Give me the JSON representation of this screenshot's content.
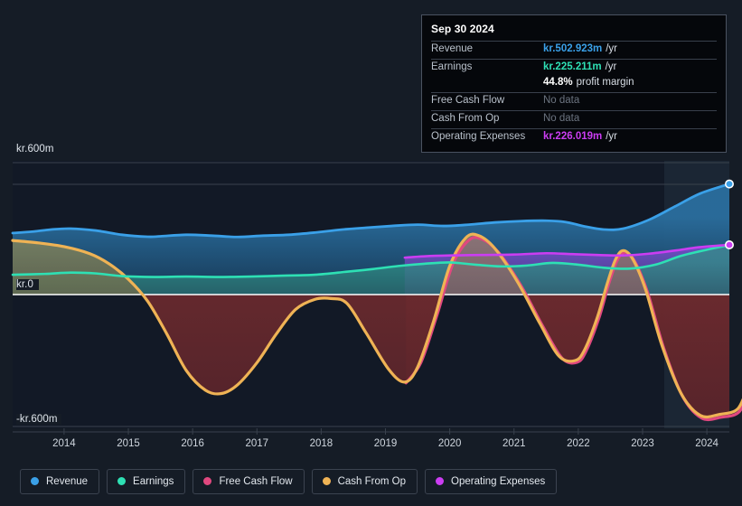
{
  "tooltip": {
    "date": "Sep 30 2024",
    "rows": [
      {
        "label": "Revenue",
        "value": "kr.502.923m",
        "unit": "/yr",
        "color": "#3aa0e8",
        "nodata": false
      },
      {
        "label": "Earnings",
        "value": "kr.225.211m",
        "unit": "/yr",
        "color": "#2ee0b4",
        "nodata": false
      },
      {
        "label": "",
        "value": "44.8%",
        "unit": "profit margin",
        "color": "#ffffff",
        "nodata": false
      },
      {
        "label": "Free Cash Flow",
        "value": "No data",
        "unit": "",
        "color": "#6c7480",
        "nodata": true
      },
      {
        "label": "Cash From Op",
        "value": "No data",
        "unit": "",
        "color": "#6c7480",
        "nodata": true
      },
      {
        "label": "Operating Expenses",
        "value": "kr.226.019m",
        "unit": "/yr",
        "color": "#cb3df2",
        "nodata": false
      }
    ]
  },
  "legend": {
    "items": [
      {
        "label": "Revenue",
        "color": "#3aa0e8"
      },
      {
        "label": "Earnings",
        "color": "#2ee0b4"
      },
      {
        "label": "Free Cash Flow",
        "color": "#e0487f"
      },
      {
        "label": "Cash From Op",
        "color": "#efb355"
      },
      {
        "label": "Operating Expenses",
        "color": "#cb3df2"
      }
    ]
  },
  "chart_data": {
    "type": "area",
    "title": "",
    "xlabel": "",
    "ylabel": "",
    "currency_prefix": "kr.",
    "units": "m",
    "ylim": [
      -600,
      600
    ],
    "y_ticks": [
      600,
      0,
      -600
    ],
    "y_tick_labels": [
      "kr.600m",
      "kr.0",
      "-kr.600m"
    ],
    "grid": true,
    "legend_position": "bottom",
    "x": [
      "2014",
      "2015",
      "2016",
      "2017",
      "2018",
      "2019",
      "2020",
      "2021",
      "2022",
      "2023",
      "2024"
    ],
    "xlim": [
      2013.7,
      2024.85
    ],
    "series": [
      {
        "name": "Revenue",
        "color": "#3aa0e8",
        "fill": "#174163",
        "end_marker": true,
        "points": [
          [
            2013.7,
            280
          ],
          [
            2014.0,
            286
          ],
          [
            2014.3,
            296
          ],
          [
            2014.6,
            300
          ],
          [
            2015.0,
            291
          ],
          [
            2015.4,
            272
          ],
          [
            2015.8,
            263
          ],
          [
            2016.0,
            265
          ],
          [
            2016.4,
            272
          ],
          [
            2016.8,
            268
          ],
          [
            2017.2,
            262
          ],
          [
            2017.6,
            268
          ],
          [
            2018.0,
            272
          ],
          [
            2018.4,
            282
          ],
          [
            2018.8,
            295
          ],
          [
            2019.2,
            304
          ],
          [
            2019.6,
            312
          ],
          [
            2020.0,
            318
          ],
          [
            2020.4,
            312
          ],
          [
            2020.8,
            318
          ],
          [
            2021.2,
            328
          ],
          [
            2021.6,
            334
          ],
          [
            2022.0,
            336
          ],
          [
            2022.3,
            330
          ],
          [
            2022.6,
            310
          ],
          [
            2022.9,
            296
          ],
          [
            2023.2,
            300
          ],
          [
            2023.6,
            340
          ],
          [
            2024.0,
            400
          ],
          [
            2024.4,
            460
          ],
          [
            2024.85,
            503
          ]
        ]
      },
      {
        "name": "Operating Expenses",
        "color": "#cb3df2",
        "fill": "#4e3a8e",
        "end_marker": true,
        "starts_at": 2019.8,
        "points": [
          [
            2019.8,
            168
          ],
          [
            2020.1,
            174
          ],
          [
            2020.5,
            178
          ],
          [
            2021.0,
            180
          ],
          [
            2021.5,
            182
          ],
          [
            2022.0,
            188
          ],
          [
            2022.4,
            184
          ],
          [
            2022.8,
            180
          ],
          [
            2023.2,
            178
          ],
          [
            2023.6,
            186
          ],
          [
            2024.0,
            200
          ],
          [
            2024.4,
            216
          ],
          [
            2024.85,
            226
          ]
        ]
      },
      {
        "name": "Earnings",
        "color": "#2ee0b4",
        "fill": "#1d6a66",
        "end_marker": false,
        "points": [
          [
            2013.7,
            90
          ],
          [
            2014.2,
            94
          ],
          [
            2014.6,
            100
          ],
          [
            2015.0,
            96
          ],
          [
            2015.4,
            84
          ],
          [
            2015.9,
            80
          ],
          [
            2016.4,
            82
          ],
          [
            2016.9,
            80
          ],
          [
            2017.4,
            82
          ],
          [
            2017.9,
            86
          ],
          [
            2018.4,
            90
          ],
          [
            2018.9,
            104
          ],
          [
            2019.3,
            116
          ],
          [
            2019.7,
            130
          ],
          [
            2020.1,
            140
          ],
          [
            2020.5,
            146
          ],
          [
            2020.9,
            136
          ],
          [
            2021.3,
            128
          ],
          [
            2021.7,
            132
          ],
          [
            2022.1,
            144
          ],
          [
            2022.5,
            136
          ],
          [
            2022.9,
            122
          ],
          [
            2023.3,
            118
          ],
          [
            2023.7,
            136
          ],
          [
            2024.1,
            176
          ],
          [
            2024.5,
            204
          ],
          [
            2024.85,
            225
          ]
        ]
      },
      {
        "name": "Cash From Op",
        "color": "#efb355",
        "fill_pos": "#6b6a4a",
        "fill_neg": "#5a2326",
        "end_marker": false,
        "ends_at": 2023.98,
        "points": [
          [
            2013.7,
            246
          ],
          [
            2014.1,
            235
          ],
          [
            2014.5,
            218
          ],
          [
            2014.9,
            186
          ],
          [
            2015.2,
            140
          ],
          [
            2015.5,
            70
          ],
          [
            2015.8,
            -30
          ],
          [
            2016.1,
            -180
          ],
          [
            2016.4,
            -345
          ],
          [
            2016.7,
            -435
          ],
          [
            2016.95,
            -450
          ],
          [
            2017.2,
            -410
          ],
          [
            2017.5,
            -310
          ],
          [
            2017.8,
            -180
          ],
          [
            2018.1,
            -68
          ],
          [
            2018.4,
            -22
          ],
          [
            2018.65,
            -18
          ],
          [
            2018.9,
            -40
          ],
          [
            2019.2,
            -175
          ],
          [
            2019.55,
            -340
          ],
          [
            2019.8,
            -398
          ],
          [
            2020.0,
            -330
          ],
          [
            2020.25,
            -120
          ],
          [
            2020.5,
            130
          ],
          [
            2020.75,
            258
          ],
          [
            2020.95,
            268
          ],
          [
            2021.2,
            210
          ],
          [
            2021.55,
            60
          ],
          [
            2021.9,
            -130
          ],
          [
            2022.2,
            -280
          ],
          [
            2022.45,
            -300
          ],
          [
            2022.6,
            -250
          ],
          [
            2022.8,
            -100
          ],
          [
            2022.95,
            50
          ],
          [
            2023.08,
            160
          ],
          [
            2023.2,
            200
          ],
          [
            2023.35,
            160
          ],
          [
            2023.55,
            20
          ],
          [
            2023.8,
            -230
          ],
          [
            2024.1,
            -450
          ],
          [
            2024.4,
            -550
          ],
          [
            2024.7,
            -545
          ],
          [
            2024.98,
            -520
          ],
          [
            2025.15,
            -420
          ],
          [
            2025.3,
            -395
          ]
        ]
      },
      {
        "name": "Free Cash Flow",
        "color": "#e0487f",
        "fill_pos": "#7a5d6e",
        "fill_neg": "#5a2326",
        "end_marker": false,
        "starts_at": 2019.82,
        "ends_at": 2023.98,
        "points": [
          [
            2019.82,
            -402
          ],
          [
            2020.05,
            -310
          ],
          [
            2020.3,
            -95
          ],
          [
            2020.55,
            140
          ],
          [
            2020.8,
            248
          ],
          [
            2021.0,
            252
          ],
          [
            2021.25,
            195
          ],
          [
            2021.6,
            45
          ],
          [
            2021.95,
            -145
          ],
          [
            2022.25,
            -290
          ],
          [
            2022.48,
            -308
          ],
          [
            2022.62,
            -258
          ],
          [
            2022.82,
            -108
          ],
          [
            2022.97,
            45
          ],
          [
            2023.1,
            152
          ],
          [
            2023.22,
            192
          ],
          [
            2023.38,
            150
          ],
          [
            2023.58,
            8
          ],
          [
            2023.83,
            -244
          ],
          [
            2024.12,
            -462
          ],
          [
            2024.42,
            -562
          ],
          [
            2024.72,
            -558
          ],
          [
            2025.0,
            -534
          ],
          [
            2025.17,
            -432
          ],
          [
            2025.32,
            -408
          ]
        ]
      }
    ]
  }
}
